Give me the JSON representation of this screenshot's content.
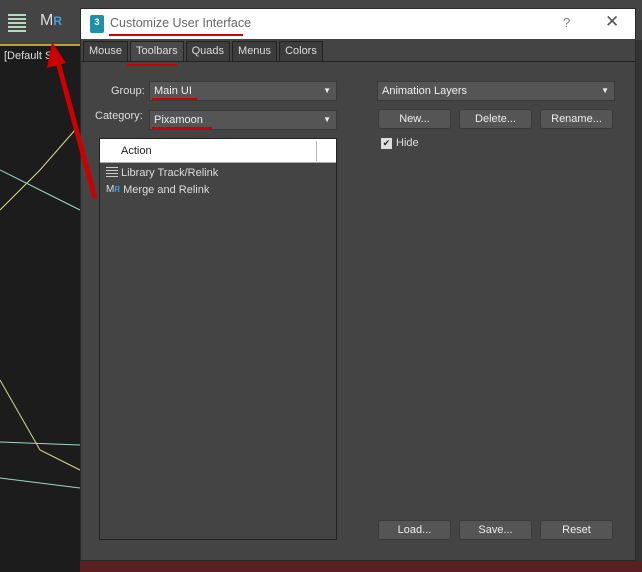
{
  "viewport": {
    "label": "[Default S"
  },
  "toolbar": {
    "icons": [
      "list-icon",
      "merge-relink-icon"
    ],
    "mr_label": "MR"
  },
  "dialog": {
    "title": "Customize User Interface",
    "help": "?",
    "close": "✕",
    "logo": "3",
    "tabs": [
      {
        "label": "Mouse"
      },
      {
        "label": "Toolbars",
        "active": true
      },
      {
        "label": "Quads"
      },
      {
        "label": "Menus"
      },
      {
        "label": "Colors"
      }
    ],
    "group": {
      "label": "Group:",
      "value": "Main UI"
    },
    "category": {
      "label": "Category:",
      "value": "Pixamoon"
    },
    "list": {
      "header": "Action",
      "items": [
        {
          "label": "Library Track/Relink",
          "icon": "list-icon"
        },
        {
          "label": "Merge and Relink",
          "icon": "merge-relink-icon"
        }
      ]
    },
    "toolbar_select": {
      "value": "Animation Layers"
    },
    "buttons": {
      "new": "New...",
      "delete": "Delete...",
      "rename": "Rename...",
      "load": "Load...",
      "save": "Save...",
      "reset": "Reset"
    },
    "hide": {
      "label": "Hide",
      "checked": true
    }
  },
  "colors": {
    "annotation": "#cc0000",
    "dialog_bg": "#444444"
  }
}
